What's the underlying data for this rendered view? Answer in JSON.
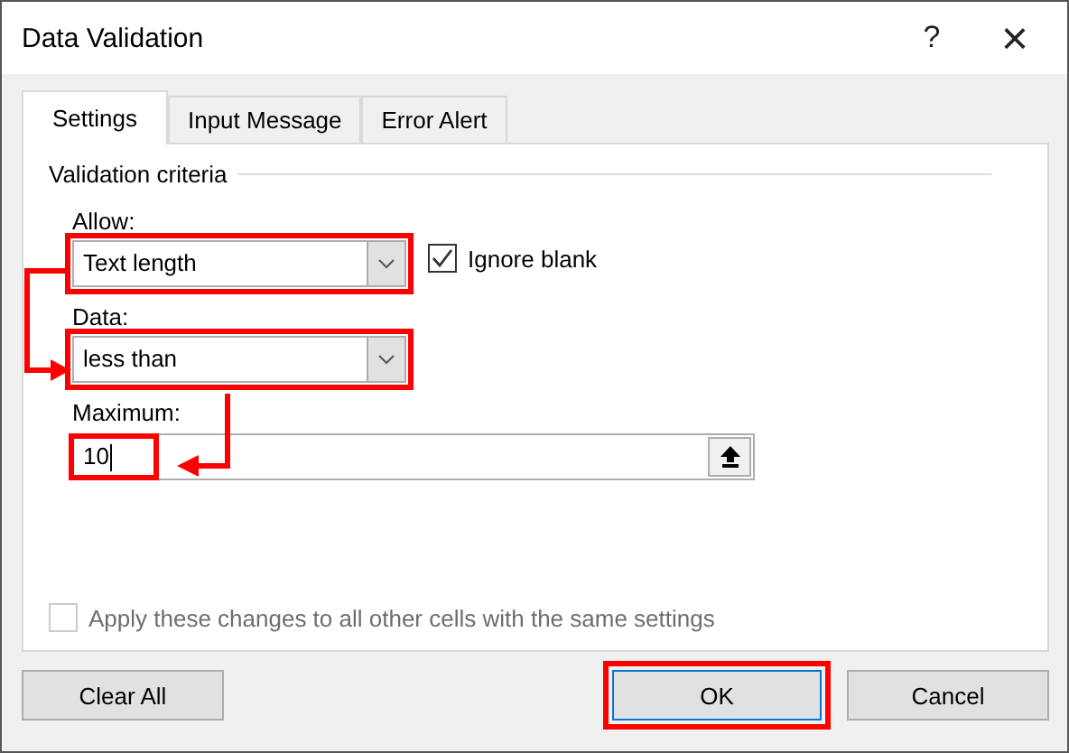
{
  "window": {
    "title": "Data Validation",
    "help": "?",
    "close": "×"
  },
  "tabs": [
    {
      "label": "Settings",
      "selected": true
    },
    {
      "label": "Input Message",
      "selected": false
    },
    {
      "label": "Error Alert",
      "selected": false
    }
  ],
  "group_title": "Validation criteria",
  "allow": {
    "label": "Allow:",
    "value": "Text length",
    "highlighted": true
  },
  "ignore_blank": {
    "label": "Ignore blank",
    "checked": true
  },
  "data": {
    "label": "Data:",
    "value": "less than",
    "highlighted": true
  },
  "maximum": {
    "label": "Maximum:",
    "value": "10",
    "highlighted": true
  },
  "apply_all": {
    "label": "Apply these changes to all other cells with the same settings",
    "checked": false,
    "disabled": true
  },
  "buttons": [
    {
      "label": "Clear All",
      "highlighted": false
    },
    {
      "label": "OK",
      "highlighted": true
    },
    {
      "label": "Cancel",
      "highlighted": false
    }
  ]
}
